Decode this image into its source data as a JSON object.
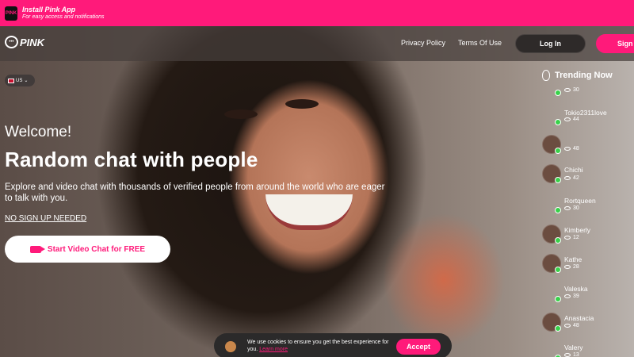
{
  "install_banner": {
    "title": "Install Pink App",
    "subtitle": "For easy access and notifications",
    "icon": "pink-app-icon",
    "color": "#ff1a7a"
  },
  "nav": {
    "logo": "PINK",
    "links": [
      "Privacy Policy",
      "Terms Of Use"
    ],
    "login": "Log In",
    "signup": "Sign"
  },
  "language": {
    "code": "US",
    "icon": "uk-flag-icon"
  },
  "hero": {
    "welcome": "Welcome!",
    "headline": "Random chat with people",
    "description": "Explore and video chat with thousands of verified people from around the world who are eager to talk with you.",
    "no_signup": "NO SIGN UP NEEDED",
    "cta": "Start Video Chat for FREE"
  },
  "trending": {
    "title": "Trending Now",
    "items": [
      {
        "name": "",
        "views": "30"
      },
      {
        "name": "Tokio2311love",
        "views": "44"
      },
      {
        "name": "",
        "views": "48"
      },
      {
        "name": "Chichi",
        "views": "42"
      },
      {
        "name": "Rortqueen",
        "views": "30"
      },
      {
        "name": "Kimberly",
        "views": "12"
      },
      {
        "name": "Kathe",
        "views": "28"
      },
      {
        "name": "Valeska",
        "views": "39"
      },
      {
        "name": "Anastacia",
        "views": "48"
      },
      {
        "name": "Valery",
        "views": "13"
      }
    ]
  },
  "cookie": {
    "text": "We use cookies to ensure you get the best experience for you.",
    "link": "Learn more",
    "accept": "Accept"
  },
  "colors": {
    "accent": "#ff1a7a",
    "online": "#38d24a"
  }
}
